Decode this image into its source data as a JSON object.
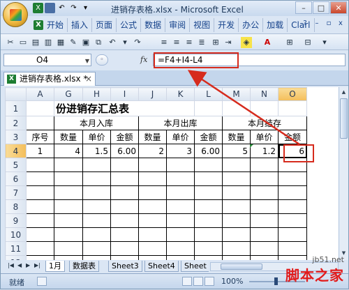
{
  "window": {
    "title": "进销存表格.xlsx - Microsoft Excel",
    "controls": [
      "–",
      "□",
      "✕"
    ]
  },
  "ribbon": {
    "tabs": [
      "开始",
      "插入",
      "页面",
      "公式",
      "数据",
      "审阅",
      "视图",
      "开发",
      "办公",
      "加载",
      "Clarl"
    ]
  },
  "formula_bar": {
    "name_box": "O4",
    "fx_label": "fx",
    "formula": "=F4+I4-L4"
  },
  "workbook_tab": {
    "label": "进销存表格.xlsx *",
    "close": "×"
  },
  "sheet": {
    "columns": [
      "A",
      "G",
      "H",
      "I",
      "J",
      "K",
      "L",
      "M",
      "N",
      "O"
    ],
    "rows": [
      "1",
      "2",
      "3",
      "4",
      "5",
      "6",
      "7",
      "8",
      "9",
      "10",
      "11",
      "12"
    ],
    "title": "份进销存汇总表",
    "groups": [
      "本月入库",
      "本月出库",
      "本月结存"
    ],
    "row3": [
      "序号",
      "数量",
      "单价",
      "金额",
      "数量",
      "单价",
      "金额",
      "数量",
      "单价",
      "金额"
    ],
    "row4": [
      "1",
      "4",
      "1.5",
      "6.00",
      "2",
      "3",
      "6.00",
      "5",
      "1.2",
      "6"
    ]
  },
  "sheet_tabs": {
    "tabs": [
      "1月",
      "数据表",
      "Sheet3",
      "Sheet4",
      "Sheet"
    ],
    "active": 0
  },
  "status_bar": {
    "ready": "就绪",
    "zoom": "100%"
  },
  "watermark": {
    "site": "jb51.net",
    "brand": "脚本之家"
  },
  "colors": {
    "highlight": "#d62b1d",
    "selection_header": "#f4be5a"
  }
}
